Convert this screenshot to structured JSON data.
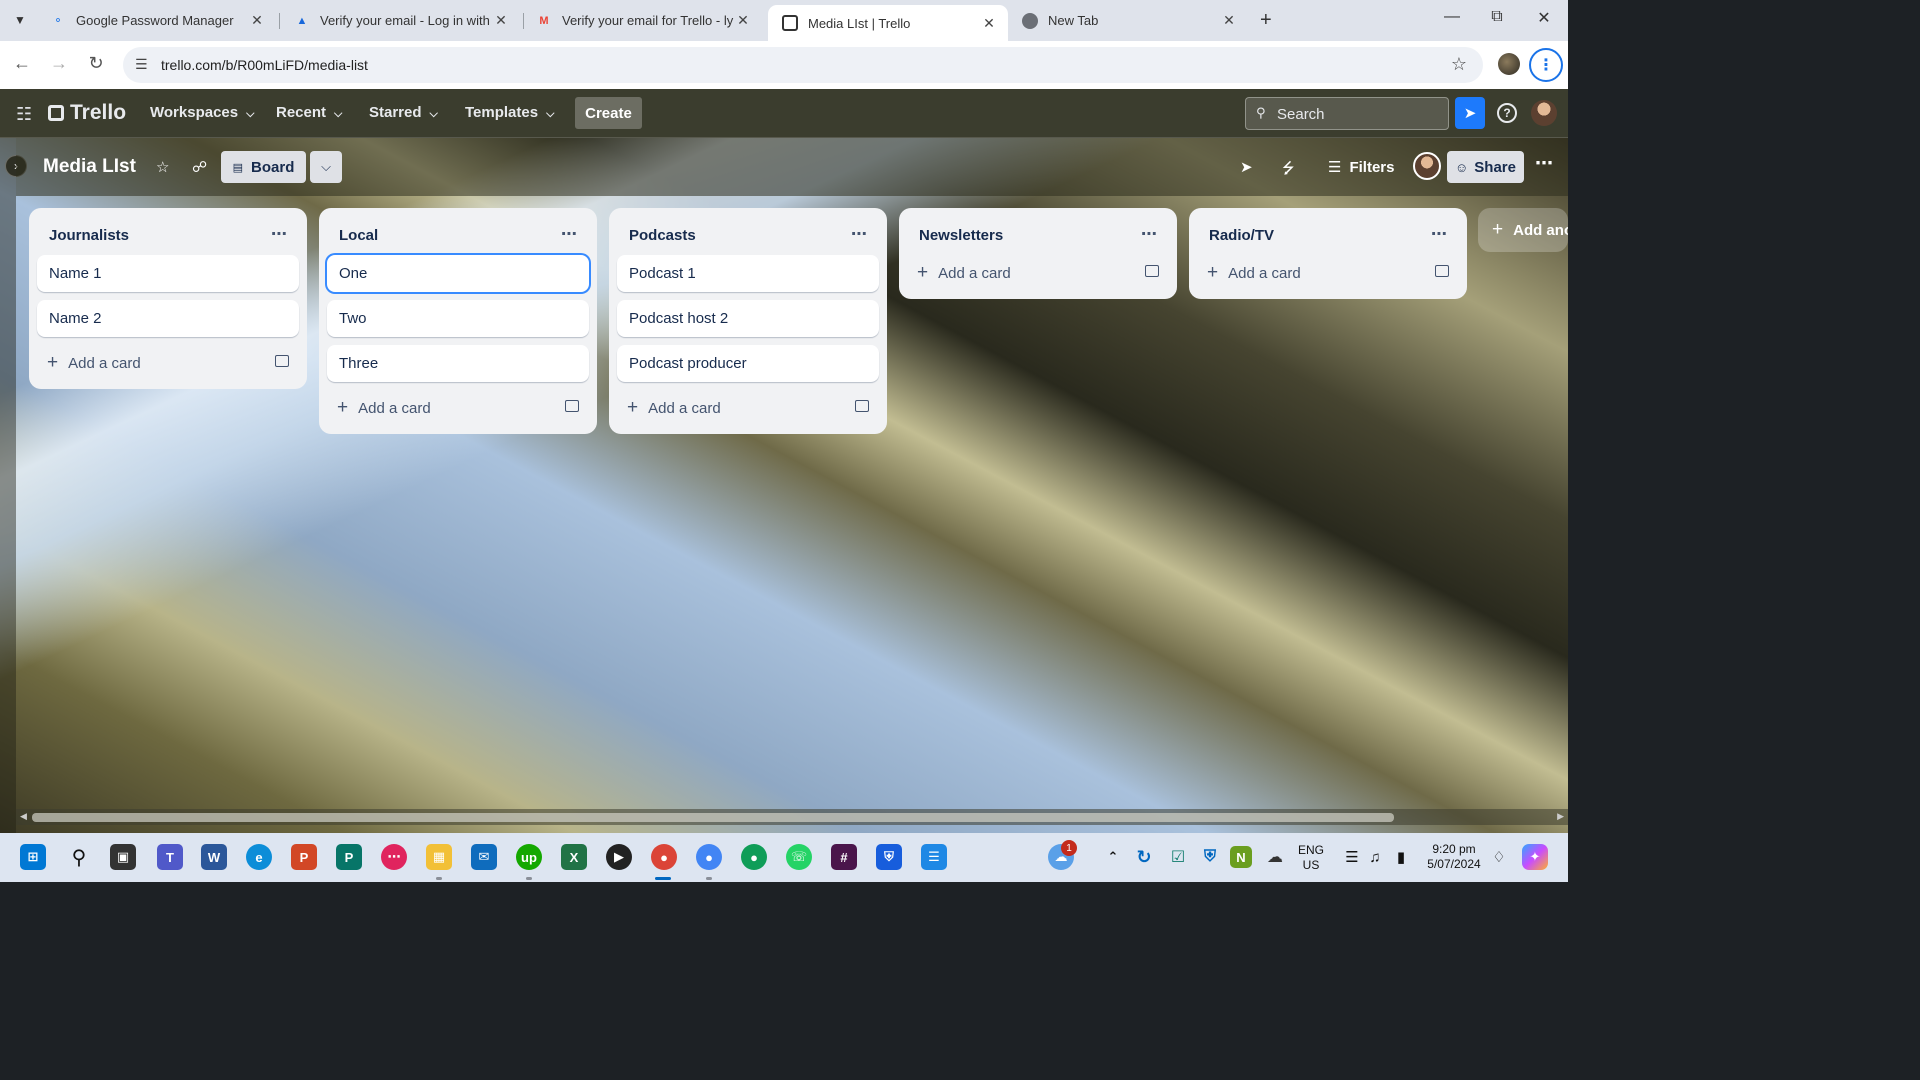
{
  "browser": {
    "tabs": [
      {
        "title": "Google Password Manager",
        "icon": "password-manager-icon"
      },
      {
        "title": "Verify your email - Log in with A",
        "icon": "atlassian-icon"
      },
      {
        "title": "Verify your email for Trello - lyn",
        "icon": "gmail-icon"
      },
      {
        "title": "Media LIst | Trello",
        "icon": "trello-icon",
        "active": true
      },
      {
        "title": "New Tab",
        "icon": "chrome-icon"
      }
    ],
    "url": "trello.com/b/R00mLiFD/media-list"
  },
  "trello_header": {
    "logo": "Trello",
    "menus": [
      "Workspaces",
      "Recent",
      "Starred",
      "Templates"
    ],
    "create": "Create",
    "search_placeholder": "Search"
  },
  "board": {
    "title": "Media LIst",
    "view": "Board",
    "filters": "Filters",
    "share": "Share",
    "add_list": "Add another list",
    "lists": [
      {
        "title": "Journalists",
        "cards": [
          "Name 1",
          "Name 2"
        ],
        "add": "Add a card"
      },
      {
        "title": "Local",
        "cards": [
          "One",
          "Two",
          "Three"
        ],
        "add": "Add a card"
      },
      {
        "title": "Podcasts",
        "cards": [
          "Podcast 1",
          "Podcast host 2",
          "Podcast producer"
        ],
        "add": "Add a card"
      },
      {
        "title": "Newsletters",
        "cards": [],
        "add": "Add a card"
      },
      {
        "title": "Radio/TV",
        "cards": [],
        "add": "Add a card"
      }
    ]
  },
  "taskbar": {
    "notification_count": "1",
    "language": "ENG",
    "region": "US",
    "time": "9:20 pm",
    "date": "5/07/2024"
  },
  "colors": {
    "trello_header_bg": "#3b3d2e",
    "list_bg": "#f1f2f4",
    "accent_blue": "#1d7afc",
    "focus_ring": "#388bff"
  }
}
